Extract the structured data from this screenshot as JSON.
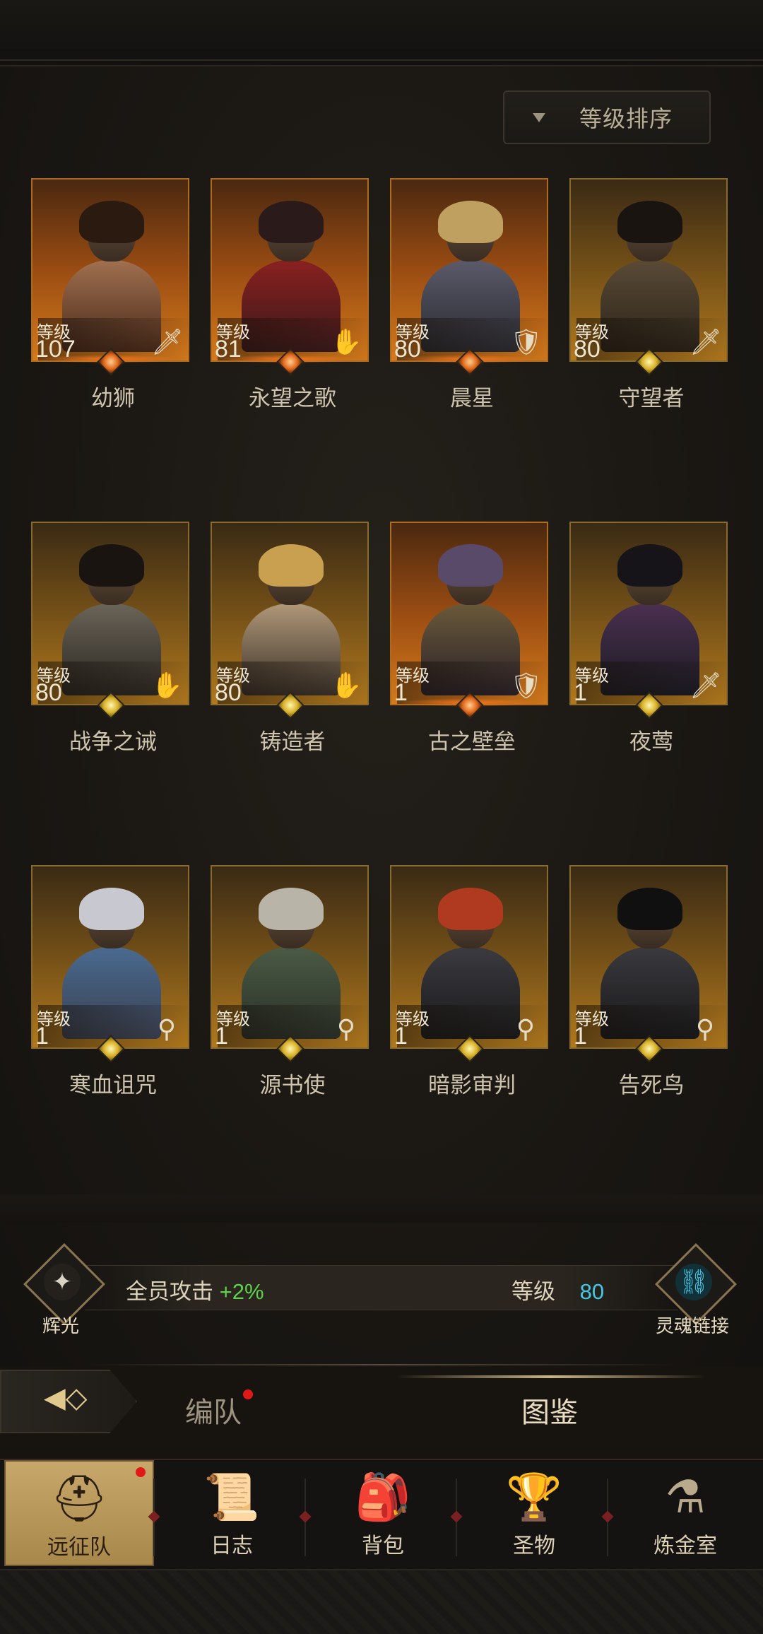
{
  "sort_button": {
    "label": "等级排序"
  },
  "heroes": [
    {
      "name": "幼狮",
      "level_label": "等级",
      "level": "107",
      "class_icon": "sword-icon",
      "frame": "orange",
      "gem": "star"
    },
    {
      "name": "永望之歌",
      "level_label": "等级",
      "level": "81",
      "class_icon": "hand-icon",
      "frame": "orange",
      "gem": "star"
    },
    {
      "name": "晨星",
      "level_label": "等级",
      "level": "80",
      "class_icon": "shield-icon",
      "frame": "orange",
      "gem": "star"
    },
    {
      "name": "守望者",
      "level_label": "等级",
      "level": "80",
      "class_icon": "sword-icon",
      "frame": "gold",
      "gem": "diamond"
    },
    {
      "name": "战争之诫",
      "level_label": "等级",
      "level": "80",
      "class_icon": "hand-icon",
      "frame": "gold",
      "gem": "diamond"
    },
    {
      "name": "铸造者",
      "level_label": "等级",
      "level": "80",
      "class_icon": "hand-icon",
      "frame": "gold",
      "gem": "diamond"
    },
    {
      "name": "古之壁垒",
      "level_label": "等级",
      "level": "1",
      "class_icon": "shield-icon",
      "frame": "orange",
      "gem": "star"
    },
    {
      "name": "夜莺",
      "level_label": "等级",
      "level": "1",
      "class_icon": "sword-icon",
      "frame": "gold",
      "gem": "diamond"
    },
    {
      "name": "寒血诅咒",
      "level_label": "等级",
      "level": "1",
      "class_icon": "staff-icon",
      "frame": "gold",
      "gem": "diamond"
    },
    {
      "name": "源书使",
      "level_label": "等级",
      "level": "1",
      "class_icon": "staff-icon",
      "frame": "gold",
      "gem": "diamond"
    },
    {
      "name": "暗影审判",
      "level_label": "等级",
      "level": "1",
      "class_icon": "staff-icon",
      "frame": "gold",
      "gem": "diamond"
    },
    {
      "name": "告死鸟",
      "level_label": "等级",
      "level": "1",
      "class_icon": "staff-icon",
      "frame": "gold",
      "gem": "diamond"
    }
  ],
  "bonus": {
    "left_emblem_label": "辉光",
    "left_text": "全员攻击",
    "left_value": "+2%",
    "right_label": "等级",
    "right_value": "80",
    "right_emblem_label": "灵魂链接"
  },
  "tabs": {
    "formation": "编队",
    "codex": "图鉴"
  },
  "nav": [
    {
      "label": "远征队",
      "icon": "helmet-icon"
    },
    {
      "label": "日志",
      "icon": "scroll-icon"
    },
    {
      "label": "背包",
      "icon": "bag-icon"
    },
    {
      "label": "圣物",
      "icon": "relic-icon"
    },
    {
      "label": "炼金室",
      "icon": "alchemy-icon"
    }
  ],
  "colors": {
    "accent_gold": "#c9a24a",
    "bonus_green": "#5ed14a",
    "level_cyan": "#45c8e6",
    "notify_red": "#e01818"
  }
}
